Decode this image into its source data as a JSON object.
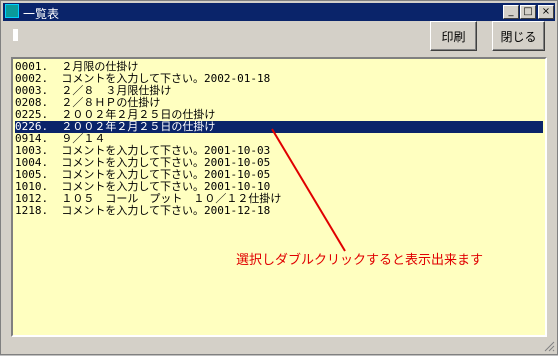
{
  "window": {
    "title": "一覧表"
  },
  "title_buttons": {
    "minimize": "_",
    "maximize": "□",
    "close": "×"
  },
  "toolbar": {
    "print_label": "印刷",
    "close_label": "閉じる"
  },
  "list": {
    "items": [
      {
        "id": "0001.",
        "text": "２月限の仕掛け"
      },
      {
        "id": "0002.",
        "text": "コメントを入力して下さい。2002-01-18"
      },
      {
        "id": "0003.",
        "text": "２／８　３月限仕掛け"
      },
      {
        "id": "0208.",
        "text": "２／８ＨＰの仕掛け"
      },
      {
        "id": "0225.",
        "text": "２００２年２月２５日の仕掛け"
      },
      {
        "id": "0226.",
        "text": "２００２年２月２５日の仕掛け",
        "selected": true
      },
      {
        "id": "0914.",
        "text": "９／１４"
      },
      {
        "id": "1003.",
        "text": "コメントを入力して下さい。2001-10-03"
      },
      {
        "id": "1004.",
        "text": "コメントを入力して下さい。2001-10-05"
      },
      {
        "id": "1005.",
        "text": "コメントを入力して下さい。2001-10-05"
      },
      {
        "id": "1010.",
        "text": "コメントを入力して下さい。2001-10-10"
      },
      {
        "id": "1012.",
        "text": "１０５　コール　プット　１０／１２仕掛け"
      },
      {
        "id": "1218.",
        "text": "コメントを入力して下さい。2001-12-18"
      }
    ]
  },
  "annotation": {
    "text": "選択しダブルクリックすると表示出来ます",
    "color": "#e00000"
  },
  "colors": {
    "list_bg": "#ffffc0",
    "selection": "#0a246a",
    "title_bar": "#0a246a"
  }
}
